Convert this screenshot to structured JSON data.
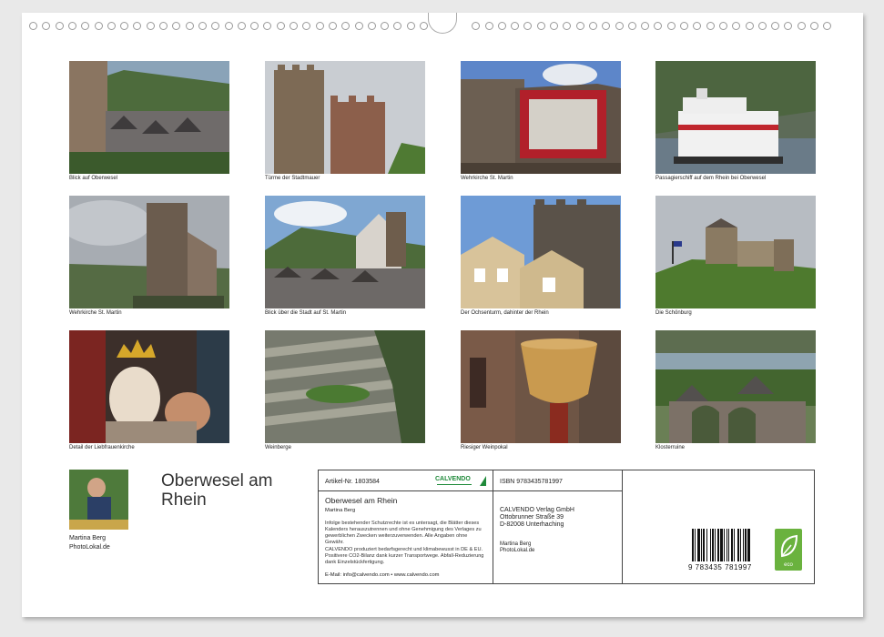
{
  "photos": [
    {
      "caption": "Blick auf Oberwesel"
    },
    {
      "caption": "Türme der Stadtmauer"
    },
    {
      "caption": "Wehrkirche St. Martin"
    },
    {
      "caption": "Passagierschiff auf dem Rhein bei Oberwesel"
    },
    {
      "caption": "Wehrkirche St. Martin"
    },
    {
      "caption": "Blick über die Stadt auf St. Martin"
    },
    {
      "caption": "Der Ochsenturm, dahinter der Rhein"
    },
    {
      "caption": "Die Schönburg"
    },
    {
      "caption": "Detail der Liebfrauenkirche"
    },
    {
      "caption": "Weinberge"
    },
    {
      "caption": "Riesiger Weinpokal"
    },
    {
      "caption": "Klosterruine"
    }
  ],
  "title_line1": "Oberwesel am",
  "title_line2": "Rhein",
  "author": {
    "name": "Martina Berg",
    "site": "PhotoLokal.de"
  },
  "info": {
    "article": "Artikel-Nr. 1803584",
    "logo": "CALVENDO",
    "book_title": "Oberwesel am Rhein",
    "book_author": "Martina Berg",
    "legal1": "Infolge bestehender Schutzrechte ist es untersagt, die Blätter dieses Kalenders herauszutrennen und ohne Genehmigung des Verlages zu gewerblichen Zwecken weiterzuverwenden. Alle Angaben ohne Gewähr.",
    "legal2": "CALVENDO produziert bedarfsgerecht und klimabewusst in DE & EU. Positivere CO2-Bilanz dank kurzer Transportwege. Abfall-Reduzierung dank Einzelstückfertigung.",
    "contact": "E-Mail: info@calvendo.com • www.calvendo.com",
    "isbn": "ISBN 9783435781997",
    "publisher1": "CALVENDO Verlag GmbH",
    "publisher2": "Ottobrunner Straße 39",
    "publisher3": "D-82008 Unterhaching",
    "pub_author1": "Martina Berg",
    "pub_author2": "PhotoLokal.de",
    "barcode_number": "9 783435 781997",
    "eco_label": "eco"
  }
}
